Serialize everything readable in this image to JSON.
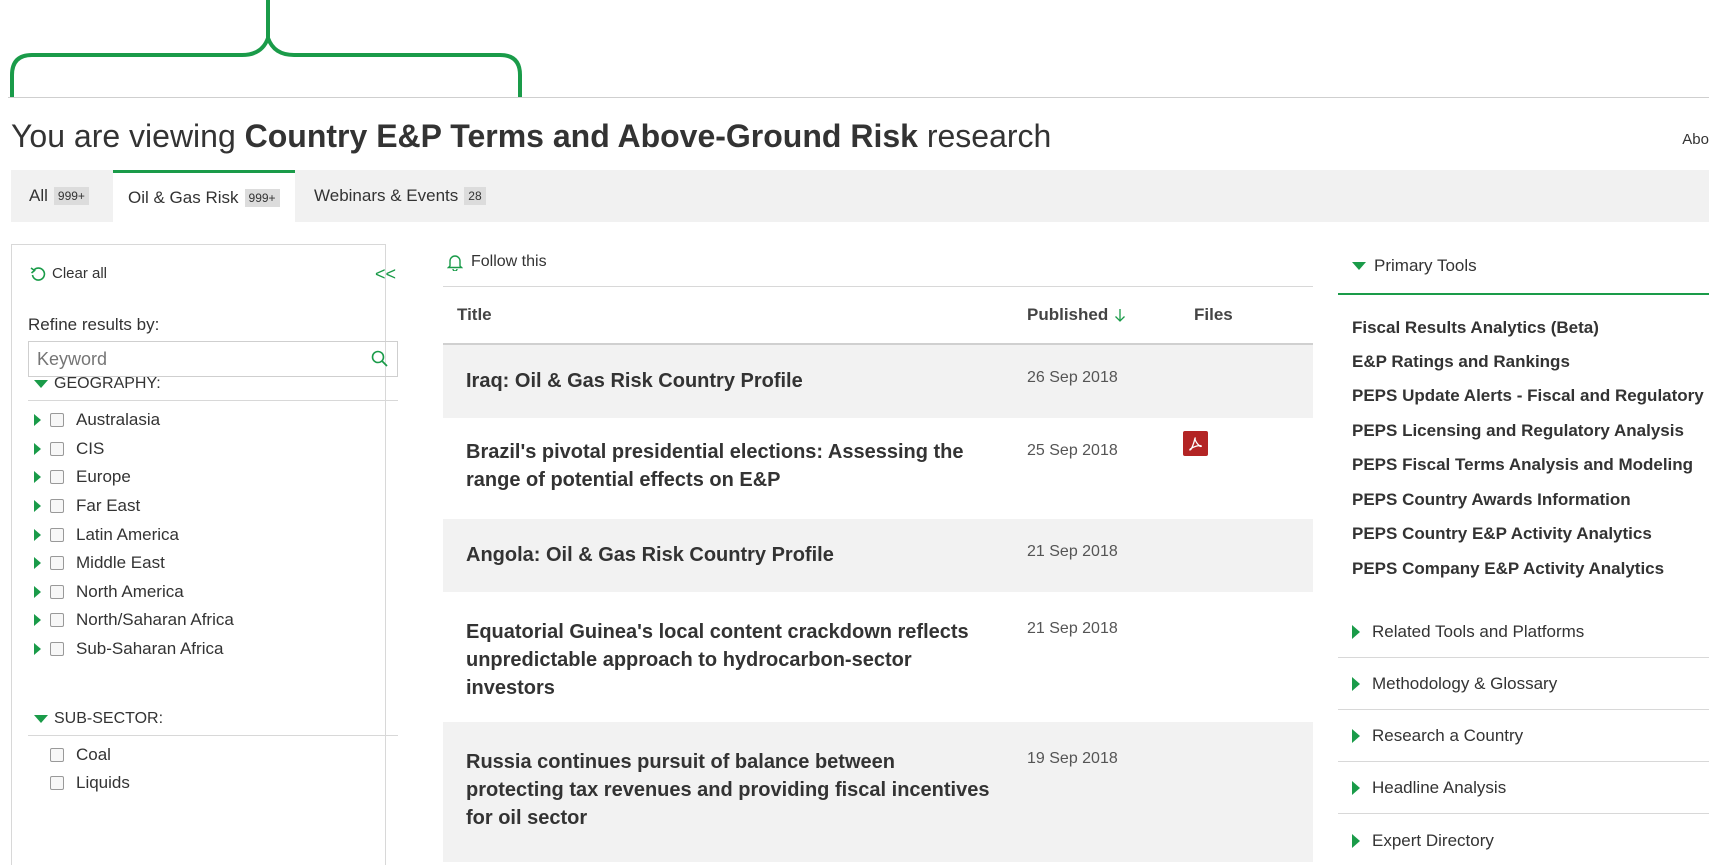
{
  "header": {
    "prefix": "You are viewing ",
    "topic": "Country E&P Terms and Above-Ground Risk",
    "suffix": " research",
    "about_label": "Abo"
  },
  "tabs": [
    {
      "label": "All",
      "count": "999+"
    },
    {
      "label": "Oil & Gas Risk",
      "count": "999+"
    },
    {
      "label": "Webinars & Events",
      "count": "28"
    }
  ],
  "filters": {
    "clear_all": "Clear all",
    "collapse": "<<",
    "refine_label": "Refine results by:",
    "keyword_placeholder": "Keyword",
    "geography": {
      "heading": "GEOGRAPHY:",
      "items": [
        "Australasia",
        "CIS",
        "Europe",
        "Far East",
        "Latin America",
        "Middle East",
        "North America",
        "North/Saharan Africa",
        "Sub-Saharan Africa"
      ]
    },
    "subsector": {
      "heading": "SUB-SECTOR:",
      "items": [
        "Coal",
        "Liquids"
      ]
    }
  },
  "results": {
    "follow_label": "Follow this",
    "col_title": "Title",
    "col_published": "Published",
    "col_files": "Files",
    "rows": [
      {
        "title_1": "Iraq: Oil & Gas Risk Country Profile",
        "title_2": "",
        "title_3": "",
        "date": "26 Sep 2018",
        "has_pdf": false
      },
      {
        "title_1": "Brazil's pivotal presidential elections: Assessing the",
        "title_2": "range of potential effects on E&P",
        "title_3": "",
        "date": "25 Sep 2018",
        "has_pdf": true
      },
      {
        "title_1": "Angola: Oil & Gas Risk Country Profile",
        "title_2": "",
        "title_3": "",
        "date": "21 Sep 2018",
        "has_pdf": false
      },
      {
        "title_1": "Equatorial Guinea's local content crackdown reflects",
        "title_2": "unpredictable approach to hydrocarbon-sector",
        "title_3": "investors",
        "date": "21 Sep 2018",
        "has_pdf": false
      },
      {
        "title_1": "Russia continues pursuit of balance between",
        "title_2": "protecting tax revenues and providing fiscal incentives",
        "title_3": "for oil sector",
        "date": "19 Sep 2018",
        "has_pdf": false
      }
    ]
  },
  "tools": {
    "primary_heading": "Primary Tools",
    "primary_items": [
      "Fiscal Results Analytics (Beta)",
      "E&P Ratings and Rankings",
      "PEPS Update Alerts - Fiscal and Regulatory",
      "PEPS Licensing and Regulatory Analysis",
      "PEPS Fiscal Terms Analysis and Modeling",
      "PEPS Country Awards Information",
      "PEPS Country E&P Activity Analytics",
      "PEPS Company E&P Activity Analytics"
    ],
    "sections": [
      "Related Tools and Platforms",
      "Methodology & Glossary",
      "Research a Country",
      "Headline Analysis",
      "Expert Directory"
    ]
  },
  "colors": {
    "accent": "#1a9b49",
    "pdf": "#b32424",
    "row_shade": "#f2f2f2"
  }
}
